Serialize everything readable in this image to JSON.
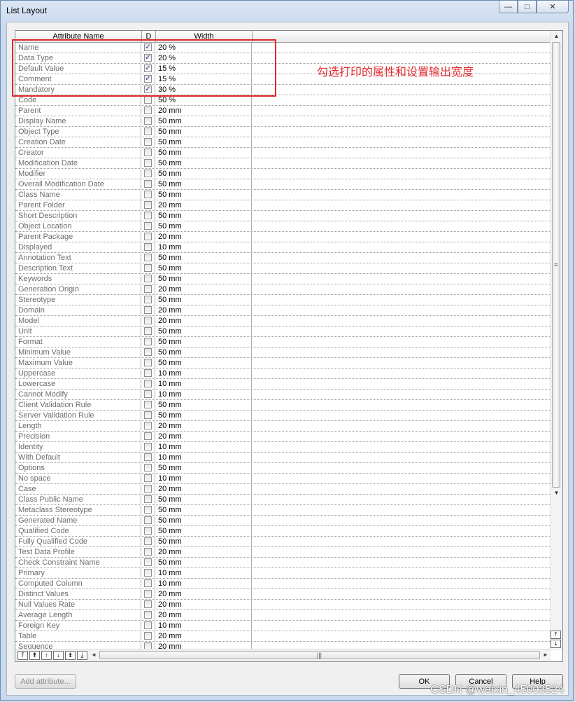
{
  "window": {
    "title": "List Layout",
    "minimize": "—",
    "maximize": "□",
    "close": "✕"
  },
  "columns": {
    "name": "Attribute Name",
    "d": "D",
    "width": "Width"
  },
  "rows": [
    {
      "name": "Name",
      "checked": true,
      "width": "20 %"
    },
    {
      "name": "Data Type",
      "checked": true,
      "width": "20 %"
    },
    {
      "name": "Default Value",
      "checked": true,
      "width": "15 %"
    },
    {
      "name": "Comment",
      "checked": true,
      "width": "15 %"
    },
    {
      "name": "Mandatory",
      "checked": true,
      "width": "30 %"
    },
    {
      "name": "Code",
      "checked": false,
      "width": "50 %"
    },
    {
      "name": "Parent",
      "checked": false,
      "width": "20 mm"
    },
    {
      "name": "Display Name",
      "checked": false,
      "width": "50 mm"
    },
    {
      "name": "Object Type",
      "checked": false,
      "width": "50 mm"
    },
    {
      "name": "Creation Date",
      "checked": false,
      "width": "50 mm"
    },
    {
      "name": "Creator",
      "checked": false,
      "width": "50 mm"
    },
    {
      "name": "Modification Date",
      "checked": false,
      "width": "50 mm"
    },
    {
      "name": "Modifier",
      "checked": false,
      "width": "50 mm"
    },
    {
      "name": "Overall Modification Date",
      "checked": false,
      "width": "50 mm"
    },
    {
      "name": "Class Name",
      "checked": false,
      "width": "50 mm"
    },
    {
      "name": "Parent Folder",
      "checked": false,
      "width": "20 mm"
    },
    {
      "name": "Short Description",
      "checked": false,
      "width": "50 mm"
    },
    {
      "name": "Object Location",
      "checked": false,
      "width": "50 mm"
    },
    {
      "name": "Parent Package",
      "checked": false,
      "width": "20 mm"
    },
    {
      "name": "Displayed",
      "checked": false,
      "width": "10 mm"
    },
    {
      "name": "Annotation Text",
      "checked": false,
      "width": "50 mm"
    },
    {
      "name": "Description Text",
      "checked": false,
      "width": "50 mm"
    },
    {
      "name": "Keywords",
      "checked": false,
      "width": "50 mm"
    },
    {
      "name": "Generation Origin",
      "checked": false,
      "width": "20 mm"
    },
    {
      "name": "Stereotype",
      "checked": false,
      "width": "50 mm"
    },
    {
      "name": "Domain",
      "checked": false,
      "width": "20 mm"
    },
    {
      "name": "Model",
      "checked": false,
      "width": "20 mm"
    },
    {
      "name": "Unit",
      "checked": false,
      "width": "50 mm"
    },
    {
      "name": "Format",
      "checked": false,
      "width": "50 mm"
    },
    {
      "name": "Minimum Value",
      "checked": false,
      "width": "50 mm"
    },
    {
      "name": "Maximum Value",
      "checked": false,
      "width": "50 mm"
    },
    {
      "name": "Uppercase",
      "checked": false,
      "width": "10 mm"
    },
    {
      "name": "Lowercase",
      "checked": false,
      "width": "10 mm"
    },
    {
      "name": "Cannot Modify",
      "checked": false,
      "width": "10 mm"
    },
    {
      "name": "Client Validation Rule",
      "checked": false,
      "width": "50 mm"
    },
    {
      "name": "Server Validation Rule",
      "checked": false,
      "width": "50 mm"
    },
    {
      "name": "Length",
      "checked": false,
      "width": "20 mm"
    },
    {
      "name": "Precision",
      "checked": false,
      "width": "20 mm"
    },
    {
      "name": "Identity",
      "checked": false,
      "width": "10 mm"
    },
    {
      "name": "With Default",
      "checked": false,
      "width": "10 mm"
    },
    {
      "name": "Options",
      "checked": false,
      "width": "50 mm"
    },
    {
      "name": "No space",
      "checked": false,
      "width": "10 mm"
    },
    {
      "name": "Case",
      "checked": false,
      "width": "20 mm"
    },
    {
      "name": "Class Public Name",
      "checked": false,
      "width": "50 mm"
    },
    {
      "name": "Metaclass Stereotype",
      "checked": false,
      "width": "50 mm"
    },
    {
      "name": "Generated Name",
      "checked": false,
      "width": "50 mm"
    },
    {
      "name": "Qualified Code",
      "checked": false,
      "width": "50 mm"
    },
    {
      "name": "Fully Qualified Code",
      "checked": false,
      "width": "50 mm"
    },
    {
      "name": "Test Data Profile",
      "checked": false,
      "width": "20 mm"
    },
    {
      "name": "Check Constraint Name",
      "checked": false,
      "width": "50 mm"
    },
    {
      "name": "Primary",
      "checked": false,
      "width": "10 mm"
    },
    {
      "name": "Computed Column",
      "checked": false,
      "width": "10 mm"
    },
    {
      "name": "Distinct Values",
      "checked": false,
      "width": "20 mm"
    },
    {
      "name": "Null Values Rate",
      "checked": false,
      "width": "20 mm"
    },
    {
      "name": "Average Length",
      "checked": false,
      "width": "20 mm"
    },
    {
      "name": "Foreign Key",
      "checked": false,
      "width": "10 mm"
    },
    {
      "name": "Table",
      "checked": false,
      "width": "20 mm"
    },
    {
      "name": "Sequence",
      "checked": false,
      "width": "20 mm"
    }
  ],
  "check_mark": "✓",
  "annotation": "勾选打印的属性和设置输出宽度",
  "toolbar": {
    "move_top": "⤒",
    "move_page_up": "⇞",
    "move_up": "↑",
    "move_down": "↓",
    "move_page_down": "⇟",
    "move_bottom": "⤓"
  },
  "scroll": {
    "up": "▲",
    "down": "▼",
    "left": "◄",
    "right": "►",
    "grip_v": "≡",
    "grip_h": "|||"
  },
  "buttons": {
    "add_attribute": "Add attribute...",
    "ok": "OK",
    "cancel": "Cancel",
    "help": "Help"
  },
  "watermark": "CSDN @weixin_45003524"
}
